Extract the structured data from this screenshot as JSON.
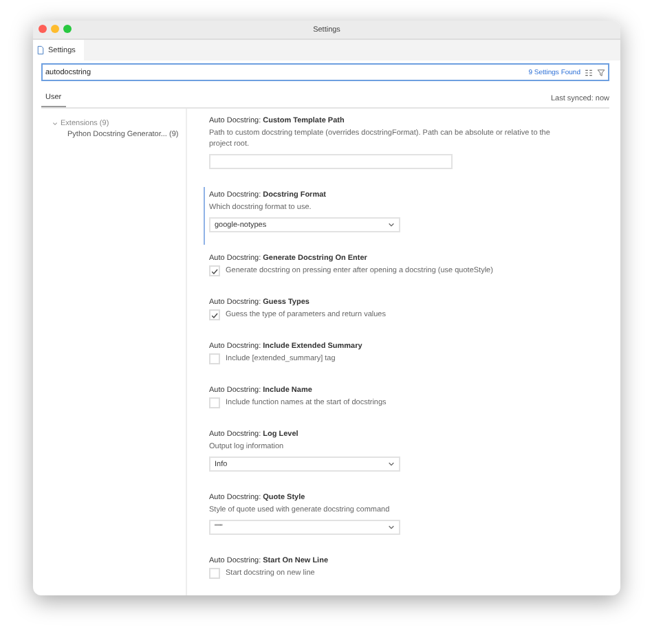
{
  "window": {
    "title": "Settings"
  },
  "tabs": [
    {
      "label": "Settings",
      "selected": true
    }
  ],
  "search": {
    "value": "autodocstring",
    "result_count": "9 Settings Found"
  },
  "scope_tabs": [
    {
      "label": "User",
      "selected": true
    }
  ],
  "sync_status": "Last synced: now",
  "sidebar": {
    "items": [
      {
        "label": "Extensions",
        "count": "(9)",
        "expanded": true,
        "children": [
          {
            "label": "Python Docstring Generator...",
            "count": "(9)"
          }
        ]
      }
    ]
  },
  "settings": [
    {
      "kind": "text",
      "title": "Auto Docstring: **Custom Template Path**",
      "description": "Path to custom docstring template (overrides docstringFormat). Path can be absolute or relative to the project root.",
      "focused": false
    },
    {
      "kind": "select",
      "title": "Auto Docstring: **Docstring Format**",
      "description": "Which docstring format to use.",
      "value": "google-notypes",
      "focused": true
    },
    {
      "kind": "checkbox",
      "title": "Auto Docstring: **Generate Docstring On Enter**",
      "description": "Generate docstring on pressing enter after opening a docstring (use quoteStyle)",
      "checked": true,
      "focused": false
    },
    {
      "kind": "checkbox",
      "title": "Auto Docstring: **Guess Types**",
      "description": "Guess the type of parameters and return values",
      "checked": true,
      "focused": false
    },
    {
      "kind": "checkbox",
      "title": "Auto Docstring: **Include Extended Summary**",
      "description": "Include [extended_summary] tag",
      "checked": false,
      "focused": false
    },
    {
      "kind": "checkbox",
      "title": "Auto Docstring: **Include Name**",
      "description": "Include function names at the start of docstrings",
      "checked": false,
      "focused": false
    },
    {
      "kind": "select",
      "title": "Auto Docstring: **Log Level**",
      "description": "Output log information",
      "value": "Info",
      "focused": false
    },
    {
      "kind": "select",
      "title": "Auto Docstring: **Quote Style**",
      "description": "Style of quote used with generate docstring command",
      "value": "\"\"\"",
      "focused": false
    },
    {
      "kind": "checkbox",
      "title": "Auto Docstring: **Start On New Line**",
      "description": "Start docstring on new line",
      "checked": false,
      "focused": false
    }
  ]
}
